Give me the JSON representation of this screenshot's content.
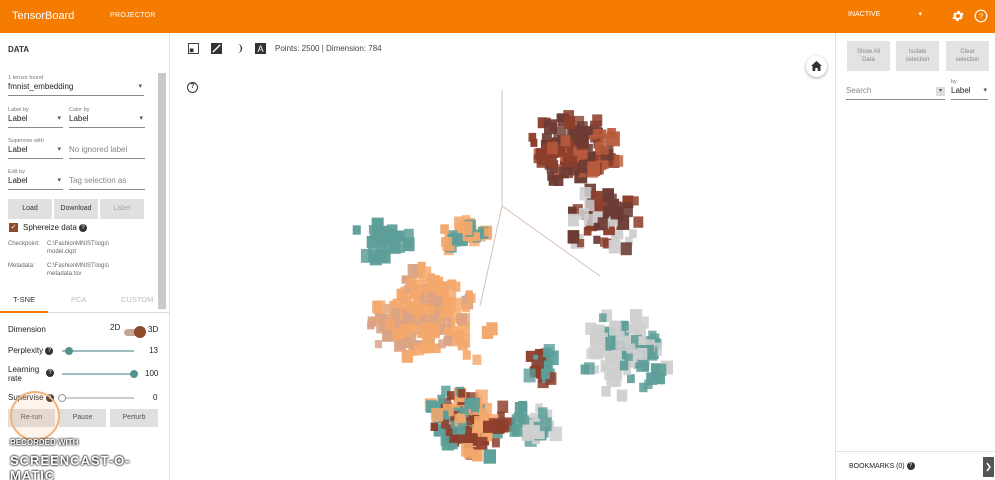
{
  "header": {
    "brand": "TensorBoard",
    "active_tab": "PROJECTOR",
    "status": "INACTIVE",
    "accent_color": "#f57c00"
  },
  "data_panel": {
    "title": "DATA",
    "tensor_label": "1 tensor found",
    "tensor_value": "fmnist_embedding",
    "label_by_label": "Label by",
    "label_by_value": "Label",
    "color_by_label": "Color by",
    "color_by_value": "Label",
    "supervise_label": "Supervise with",
    "supervise_value": "Label",
    "ignored_placeholder": "No ignored label",
    "edit_by_label": "Edit by",
    "edit_by_value": "Label",
    "tag_placeholder": "Tag selection as",
    "load_button": "Load",
    "download_button": "Download",
    "label_button": "Label",
    "sphereize_label": "Sphereize data",
    "checkpoint_key": "Checkpoint:",
    "checkpoint_line1": "C:\\FashionMNIST\\logs\\",
    "checkpoint_line2": "model.ckpt",
    "metadata_key": "Metadata:",
    "metadata_line1": "C:\\FashionMNIST\\logs\\",
    "metadata_line2": "metadata.tsv"
  },
  "projection_tabs": [
    "T-SNE",
    "PCA",
    "CUSTOM"
  ],
  "tsne": {
    "dimension_label": "Dimension",
    "dim_2d": "2D",
    "dim_3d": "3D",
    "perplexity_label": "Perplexity",
    "perplexity_value": "13",
    "perplexity_fraction": 0.1,
    "learning_rate_line1": "Learning",
    "learning_rate_line2": "rate",
    "learning_rate_value": "100",
    "learning_rate_fraction": 1.0,
    "supervise_label": "Supervise",
    "supervise_value": "0",
    "supervise_fraction": 0.0,
    "buttons": [
      "Re-run",
      "Pause",
      "Perturb"
    ]
  },
  "watermark": {
    "line1": "RECORDED WITH",
    "line2": "SCREENCAST-O-MATIC"
  },
  "toolbar": {
    "points_label": "Points: 2500",
    "dimension_label": "Dimension: 784"
  },
  "inspector": {
    "show_all_line1": "Show All",
    "show_all_line2": "Data",
    "isolate_line1": "Isolate",
    "isolate_line2": "selection",
    "clear_line1": "Clear",
    "clear_line2": "selection",
    "search_placeholder": "Search",
    "by_label": "by",
    "by_value": "Label",
    "bookmarks": "BOOKMARKS (0)"
  },
  "scatter_colors": [
    "#f4a86c",
    "#5d9e99",
    "#8d3e2c",
    "#6b3a33",
    "#cfcfcf",
    "#b85a3c",
    "#d9a386"
  ],
  "icons": [
    "settings-icon",
    "help-icon",
    "selection-box-icon",
    "night-mode-icon",
    "label-toggle-icon",
    "home-icon",
    "chevron-down-icon",
    "chevron-right-icon"
  ]
}
